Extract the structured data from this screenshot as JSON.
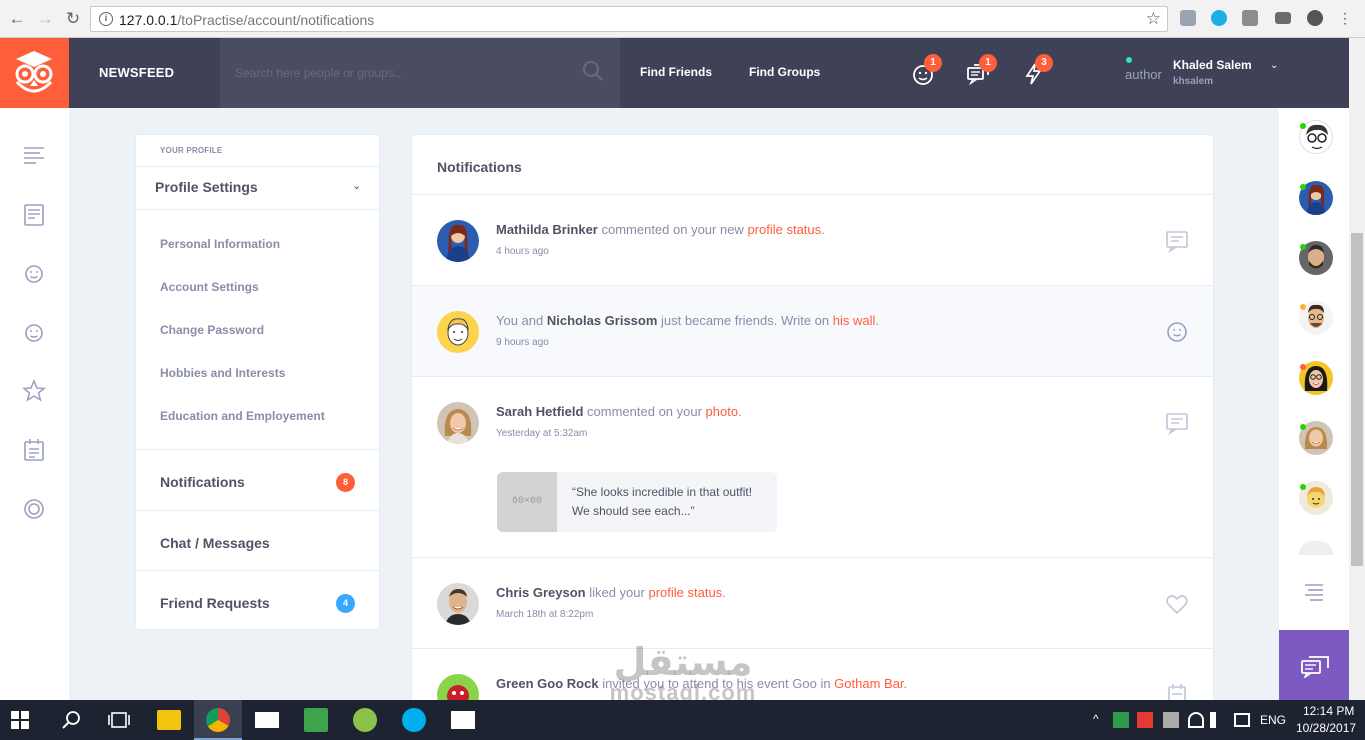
{
  "browser": {
    "url_host": "127.0.0.1",
    "url_path": "/toPractise/account/notifications"
  },
  "header": {
    "brand": "NEWSFEED",
    "search_placeholder": "Search here people or groups...",
    "links": [
      "Find Friends",
      "Find Groups"
    ],
    "badges": {
      "friend_requests": "1",
      "messages": "1",
      "activity": "3"
    },
    "user": {
      "role": "author",
      "name": "Khaled Salem",
      "handle": "khsalem"
    }
  },
  "profile_sidebar": {
    "kicker": "YOUR PROFILE",
    "title": "Profile Settings",
    "items": [
      "Personal Information",
      "Account Settings",
      "Change Password",
      "Hobbies and Interests",
      "Education and Employement"
    ],
    "sections": [
      {
        "label": "Notifications",
        "count": "8",
        "color": "#ff5e3a"
      },
      {
        "label": "Chat / Messages",
        "count": "",
        "color": ""
      },
      {
        "label": "Friend Requests",
        "count": "4",
        "color": "#38a9ff"
      }
    ]
  },
  "notifications": {
    "title": "Notifications",
    "items": [
      {
        "name": "Mathilda Brinker",
        "pre": "",
        "action": " commented on your new ",
        "link": "profile status",
        "post": ".",
        "time": "4 hours ago",
        "icon": "comment-icon"
      },
      {
        "name": "Nicholas Grissom",
        "pre": "You and ",
        "action": " just became friends. Write on ",
        "link": "his wall",
        "post": ".",
        "time": "9 hours ago",
        "icon": "smiley-icon"
      },
      {
        "name": "Sarah Hetfield",
        "pre": "",
        "action": " commented on your ",
        "link": "photo",
        "post": ".",
        "time": "Yesterday at 5:32am",
        "icon": "comment-icon",
        "thumb": "60×60",
        "quote": "“She looks incredible in that outfit! We should see each...”"
      },
      {
        "name": "Chris Greyson",
        "pre": "",
        "action": " liked your ",
        "link": "profile status",
        "post": ".",
        "time": "March 18th at 8:22pm",
        "icon": "heart-icon"
      },
      {
        "name": "Green Goo Rock",
        "pre": "",
        "action": " invited you to attend to his event Goo in ",
        "link": "Gotham Bar",
        "post": ".",
        "time": "",
        "icon": "calendar-icon"
      }
    ]
  },
  "watermark": {
    "arabic": "مستقل",
    "latin": "mostaql.com"
  },
  "taskbar": {
    "time": "12:14 PM",
    "date": "10/28/2017",
    "lang": "ENG"
  },
  "colors": {
    "accent": "#ff5e3a",
    "header": "#3f4257",
    "blue": "#38a9ff",
    "purple": "#7c5ac2"
  }
}
